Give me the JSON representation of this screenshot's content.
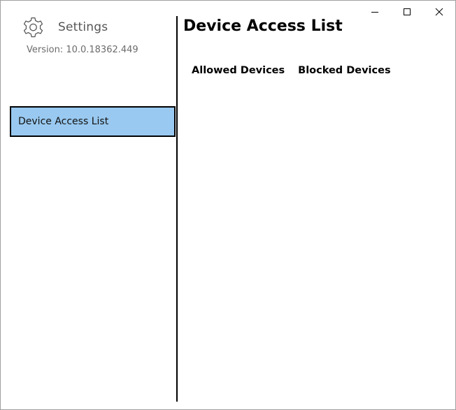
{
  "window": {
    "caption": {
      "minimize_icon": "minimize-icon",
      "maximize_icon": "maximize-icon",
      "close_icon": "close-icon"
    }
  },
  "sidebar": {
    "app_icon": "gear-icon",
    "app_title": "Settings",
    "version": "Version: 10.0.18362.449",
    "items": [
      {
        "label": "Device Access List",
        "selected": true
      }
    ],
    "selected_color": "#99c9f0"
  },
  "main": {
    "title": "Device Access List",
    "tabs": [
      {
        "label": "Allowed Devices"
      },
      {
        "label": "Blocked Devices"
      }
    ]
  }
}
